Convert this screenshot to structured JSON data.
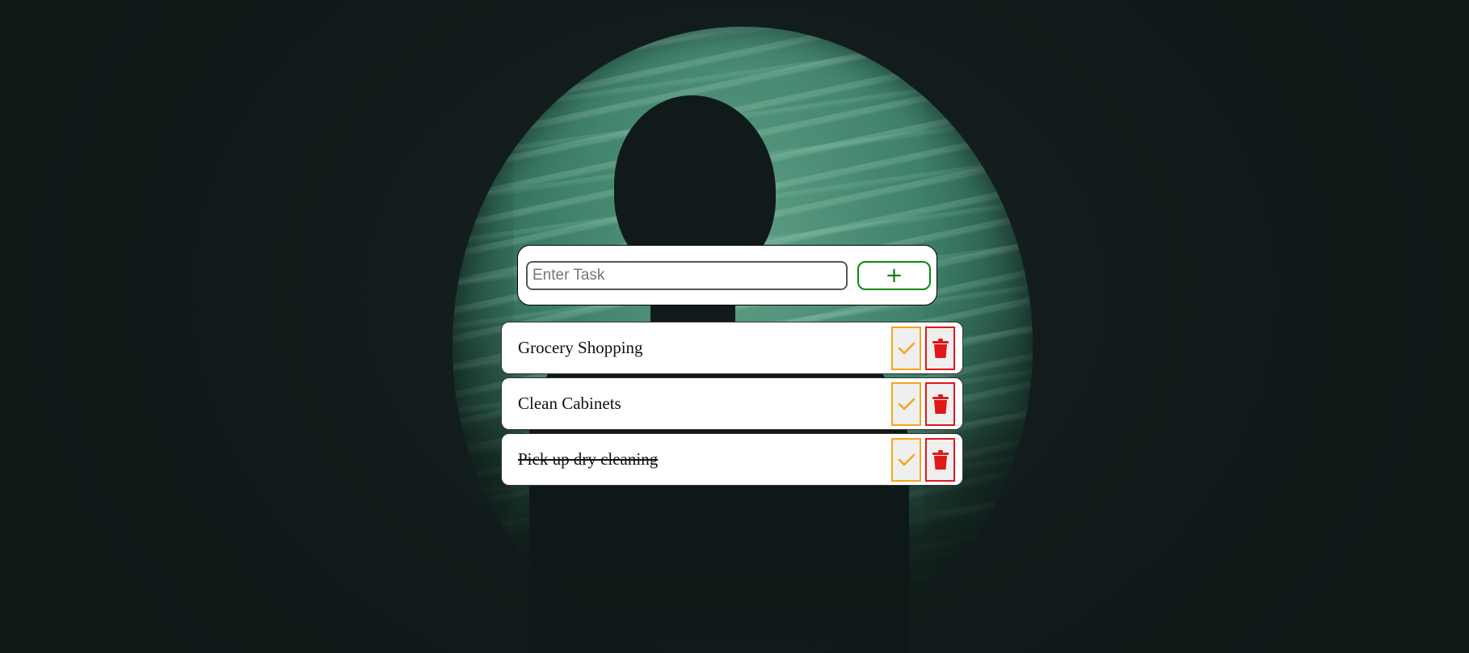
{
  "new_task": {
    "placeholder": "Enter Task",
    "value": "",
    "add_label": "+"
  },
  "tasks": [
    {
      "text": "Grocery Shopping",
      "done": false
    },
    {
      "text": "Clean Cabinets",
      "done": false
    },
    {
      "text": "Pick up dry cleaning",
      "done": true
    }
  ],
  "icons": {
    "complete": "check-icon",
    "delete": "trash-icon"
  },
  "colors": {
    "add_button": "#0a8a0a",
    "complete_button": "#f5a41a",
    "delete_button": "#e01818",
    "page_background": "#121b1b"
  }
}
